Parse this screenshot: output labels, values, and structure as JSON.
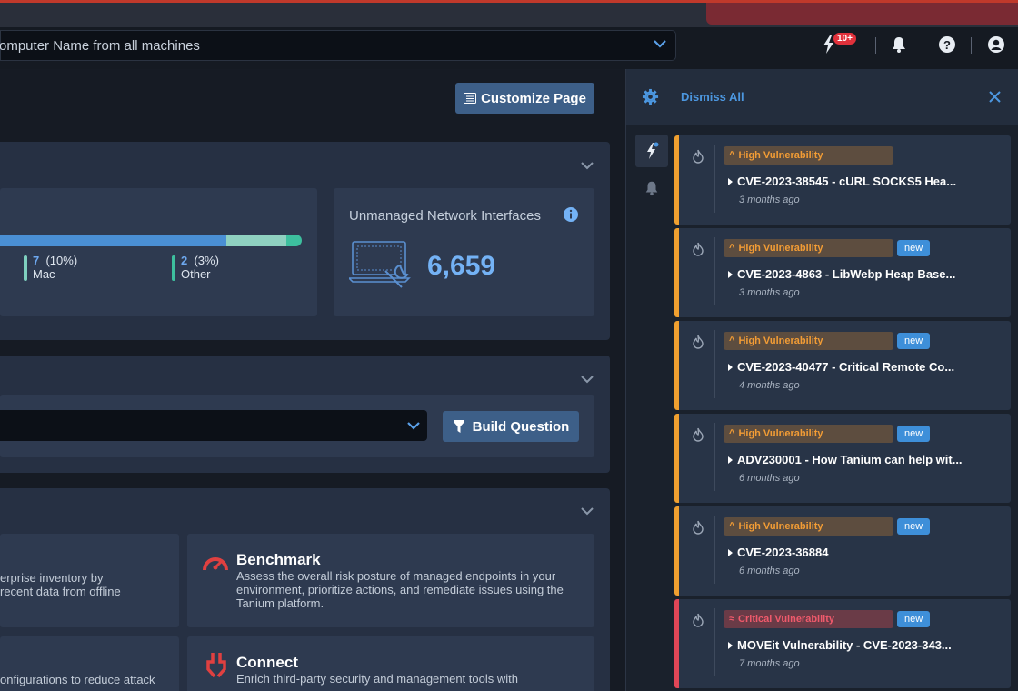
{
  "header": {
    "search_value": "omputer Name from all machines",
    "notification_count": "10+"
  },
  "main": {
    "customize_label": "Customize Page",
    "os_stats": [
      {
        "count": "7",
        "percent": "(10%)",
        "label": "Mac"
      },
      {
        "count": "2",
        "percent": "(3%)",
        "label": "Other"
      }
    ],
    "unmanaged": {
      "title": "Unmanaged Network Interfaces",
      "value": "6,659"
    },
    "build_question_label": "Build Question",
    "tiles": {
      "left_top_desc": [
        "erprise inventory by",
        "recent data from offline"
      ],
      "benchmark_title": "Benchmark",
      "benchmark_desc": "Assess the overall risk posture of managed endpoints in your environment, prioritize actions, and remediate issues using the Tanium platform.",
      "left_bottom_desc": "onfigurations to reduce attack",
      "connect_title": "Connect",
      "connect_desc": "Enrich third-party security and management tools with"
    }
  },
  "panel": {
    "dismiss_label": "Dismiss All",
    "notifications": [
      {
        "severity": "High Vulnerability",
        "is_new": false,
        "title": "CVE-2023-38545 - cURL SOCKS5 Hea...",
        "ago": "3 months ago"
      },
      {
        "severity": "High Vulnerability",
        "is_new": true,
        "new_label": "new",
        "title": "CVE-2023-4863 - LibWebp Heap Base...",
        "ago": "3 months ago"
      },
      {
        "severity": "High Vulnerability",
        "is_new": true,
        "new_label": "new",
        "title": "CVE-2023-40477 - Critical Remote Co...",
        "ago": "4 months ago"
      },
      {
        "severity": "High Vulnerability",
        "is_new": true,
        "new_label": "new",
        "title": "ADV230001 - How Tanium can help wit...",
        "ago": "6 months ago"
      },
      {
        "severity": "High Vulnerability",
        "is_new": true,
        "new_label": "new",
        "title": "CVE-2023-36884",
        "ago": "6 months ago"
      },
      {
        "severity": "Critical Vulnerability",
        "is_new": true,
        "new_label": "new",
        "title": "MOVEit Vulnerability - CVE-2023-343...",
        "ago": "7 months ago"
      }
    ]
  },
  "colors": {
    "accent": "#3d5f88",
    "high": "#f0a030",
    "critical": "#e04657",
    "link": "#4c97e0"
  },
  "icons": [
    "chevron-down-icon",
    "lightning-icon",
    "bell-icon",
    "help-icon",
    "user-icon",
    "gear-icon",
    "close-icon",
    "fire-icon",
    "filter-icon",
    "list-icon",
    "laptop-wrench-icon",
    "info-icon",
    "gauge-icon",
    "plug-icon"
  ]
}
